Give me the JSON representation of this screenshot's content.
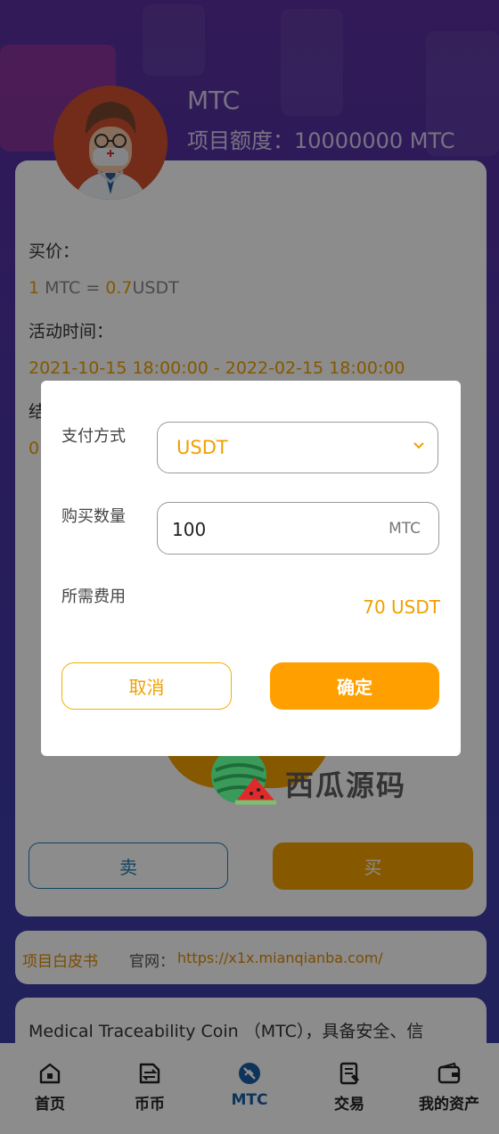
{
  "project": {
    "name": "MTC",
    "quota_label": "项目额度：10000000 MTC"
  },
  "detail": {
    "buy_price_label": "买价：",
    "price_lhs_num": "1",
    "price_lhs_unit": " MTC = ",
    "price_rhs_num": "0.7",
    "price_rhs_unit": "USDT",
    "activity_time_label": "活动时间：",
    "activity_time_value": "2021-10-15 18:00:00 - 2022-02-15 18:00:00",
    "partial_label": "结",
    "partial_value": "0"
  },
  "actions": {
    "sell_label": "卖",
    "buy_label": "买"
  },
  "links": {
    "whitepaper": "项目白皮书",
    "site_label": "官网：",
    "site_url": "https://x1x.mianqianba.com/"
  },
  "description": "Medical Traceability Coin （MTC），具备安全、信",
  "watermark": "西瓜源码",
  "modal": {
    "pay_method_label": "支付方式",
    "pay_method_value": "USDT",
    "quantity_label": "购买数量",
    "quantity_value": "100",
    "quantity_unit": "MTC",
    "fee_label": "所需费用",
    "fee_value": "70 USDT",
    "cancel_label": "取消",
    "confirm_label": "确定"
  },
  "tabbar": {
    "items": [
      {
        "label": "首页",
        "icon": "home-icon"
      },
      {
        "label": "币币",
        "icon": "exchange-icon"
      },
      {
        "label": "MTC",
        "icon": "mtc-icon"
      },
      {
        "label": "交易",
        "icon": "trade-icon"
      },
      {
        "label": "我的资产",
        "icon": "wallet-icon"
      }
    ],
    "active_index": 2,
    "active_color": "#1a5fa8"
  },
  "colors": {
    "accent": "#f5a300",
    "link_blue": "#1f7fb0"
  }
}
